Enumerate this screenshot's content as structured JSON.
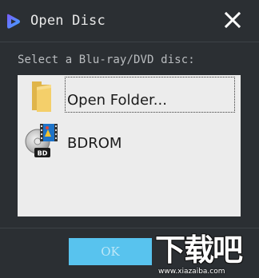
{
  "window": {
    "title": "Open Disc",
    "app_icon": "play-logo-icon",
    "close_icon": "close-icon"
  },
  "prompt": "Select a Blu-ray/DVD disc:",
  "items": [
    {
      "label": "Open Folder...",
      "icon": "folder-icon",
      "selected": true
    },
    {
      "label": "BDROM",
      "icon": "bd-disc-icon",
      "badge": "BD",
      "selected": false
    }
  ],
  "footer": {
    "ok_label": "OK",
    "ok_enabled": false
  },
  "watermark": {
    "text": "下载吧",
    "url": "www.xiazaiba.com"
  },
  "colors": {
    "background": "#2b2f33",
    "list_background": "#ececec",
    "accent": "#58c3ee",
    "title_text": "#e9e9e9"
  }
}
